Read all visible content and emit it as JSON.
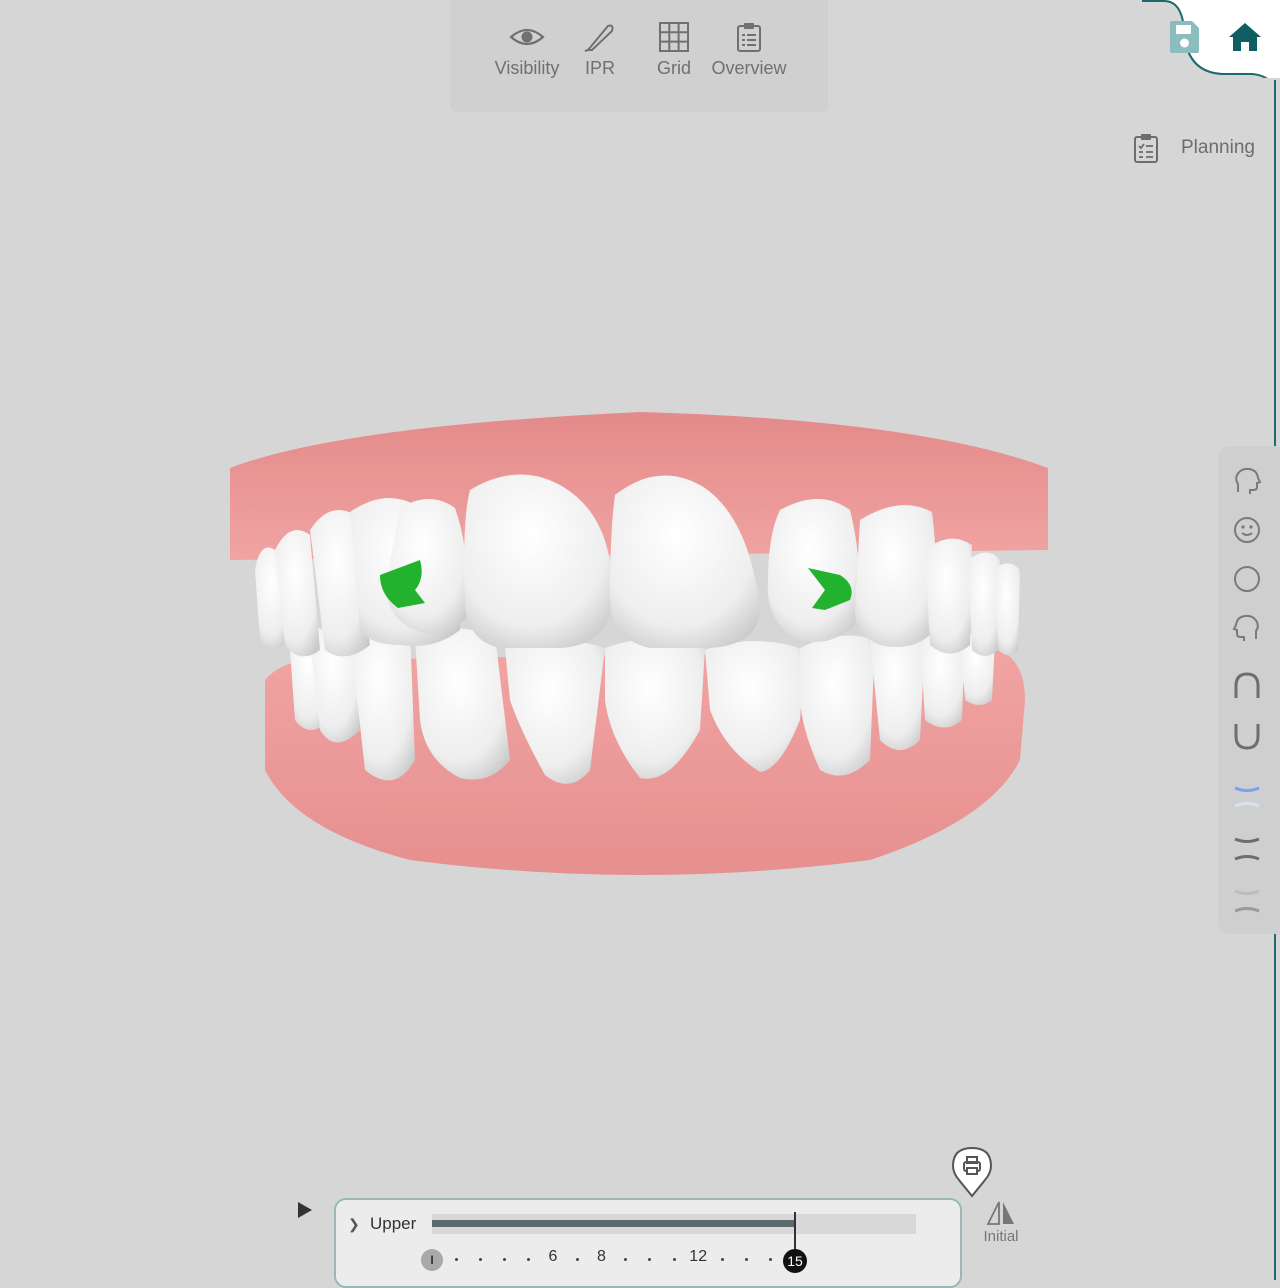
{
  "toolbar": {
    "items": [
      {
        "label": "Visibility",
        "icon": "eye-icon"
      },
      {
        "label": "IPR",
        "icon": "scalpel-icon"
      },
      {
        "label": "Grid",
        "icon": "grid-icon"
      },
      {
        "label": "Overview",
        "icon": "clipboard-icon"
      }
    ]
  },
  "header": {
    "save_icon": "save-icon",
    "home_icon": "home-icon",
    "accent": "#0f5e62"
  },
  "planning": {
    "label": "Planning",
    "icon": "clipboard-check-icon"
  },
  "sidebar": {
    "icons": [
      "head-left-icon",
      "face-front-icon",
      "circle-view-icon",
      "head-right-icon",
      "arch-upper-icon",
      "arch-lower-icon",
      "bite-front-icon",
      "bite-both-icon",
      "bite-lower-icon"
    ],
    "active_color": "#7aa2f2"
  },
  "timeline": {
    "arch_label": "Upper",
    "start_step": "I",
    "current_step": "15",
    "progress": 0.75,
    "visible_numbers": [
      "6",
      "8",
      "12"
    ]
  },
  "bottom": {
    "print_icon": "print-pin-icon",
    "initial_label": "Initial"
  },
  "colors": {
    "background": "#d6d6d6",
    "gum": "#e99595",
    "attachment": "#22b22e"
  }
}
